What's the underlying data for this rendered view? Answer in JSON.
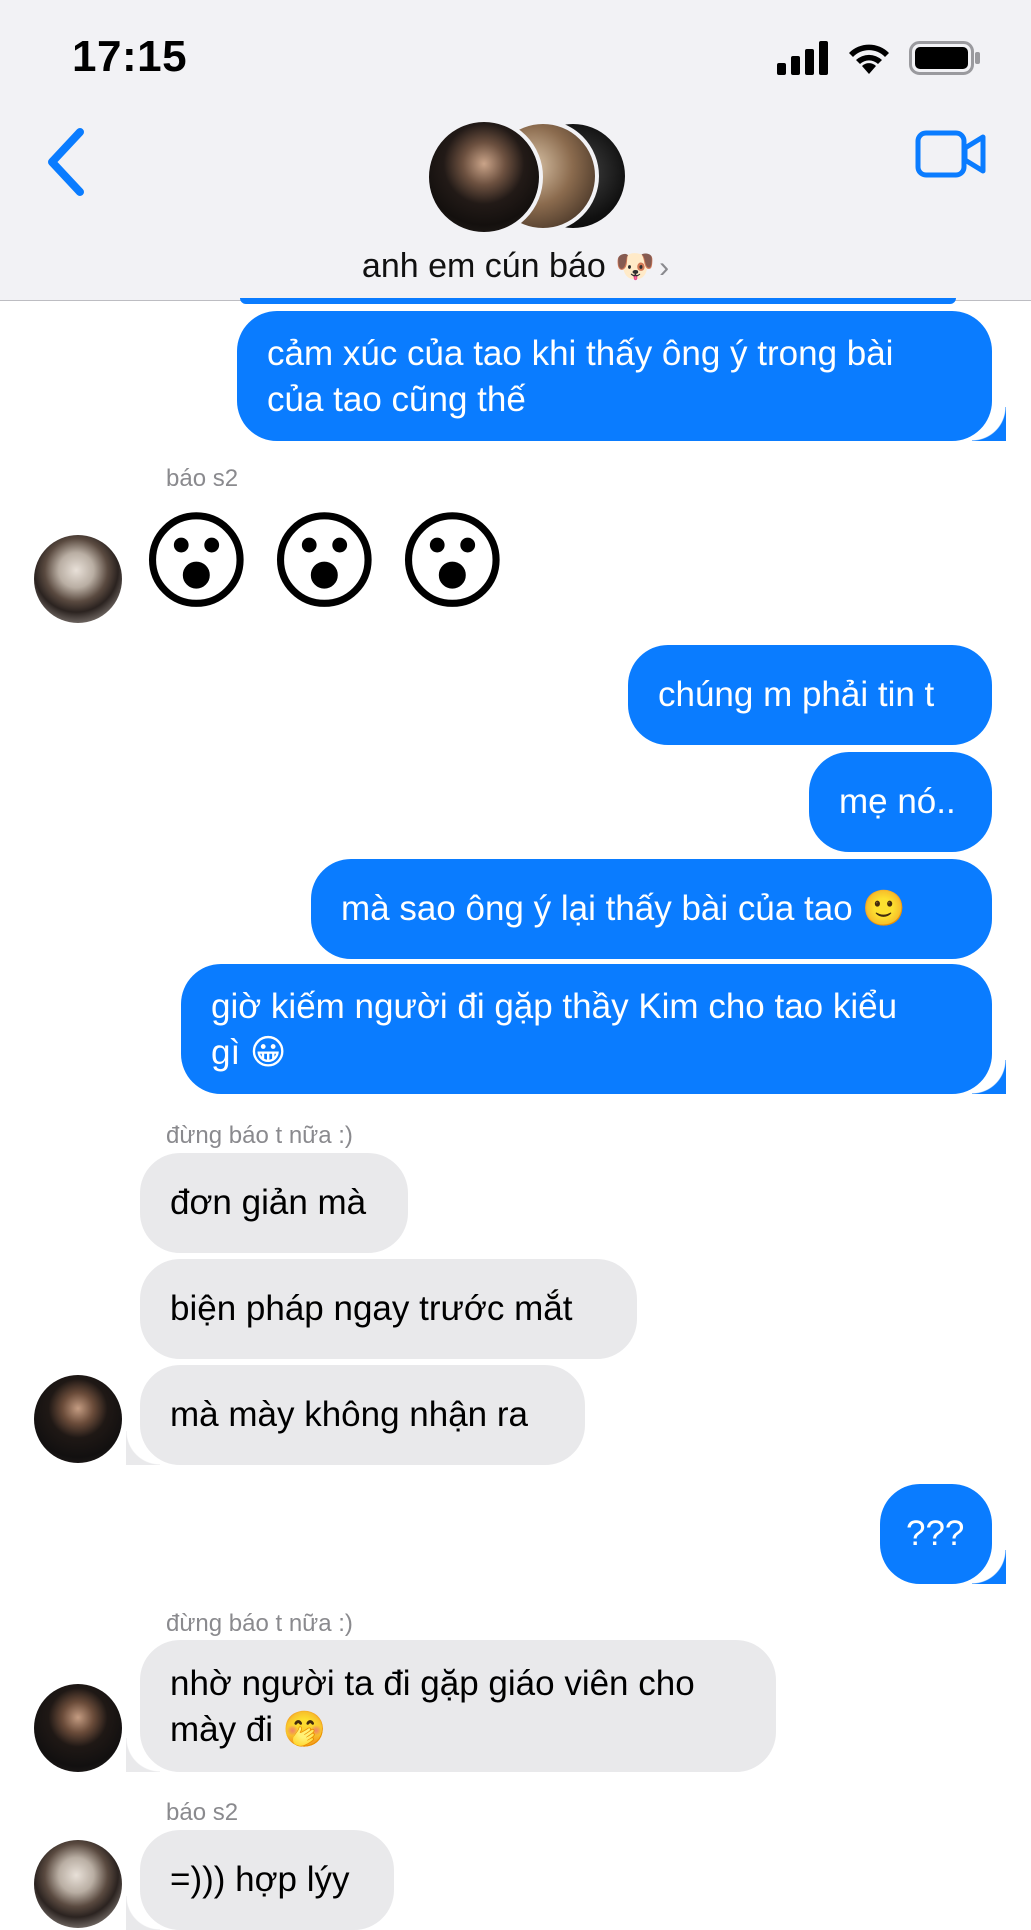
{
  "status_bar": {
    "time": "17:15"
  },
  "header": {
    "group_name": "anh em cún báo",
    "group_emoji": "🐶",
    "icons": {
      "back": "chevron-left-icon",
      "video": "video-camera-icon",
      "chevron": "chevron-right-icon"
    }
  },
  "messages": [
    {
      "dir": "out",
      "lines": [
        "cảm xúc của tao khi thấy ông ý trong bài",
        "của tao cũng thế"
      ]
    },
    {
      "dir": "in",
      "sender": "báo s2",
      "emoji": [
        "😮",
        "😮",
        "😮"
      ]
    },
    {
      "dir": "out",
      "lines": [
        "chúng m phải tin t"
      ]
    },
    {
      "dir": "out",
      "lines": [
        "mẹ nó.."
      ]
    },
    {
      "dir": "out",
      "lines": [
        "mà sao ông ý lại thấy bài của tao 🙂"
      ]
    },
    {
      "dir": "out",
      "lines": [
        "giờ kiếm người đi gặp thầy Kim cho tao kiểu",
        "gì 😀"
      ]
    },
    {
      "dir": "in",
      "sender": "đừng báo t nữa :)",
      "lines": [
        "đơn giản mà"
      ]
    },
    {
      "dir": "in",
      "lines": [
        "biện pháp ngay trước mắt"
      ]
    },
    {
      "dir": "in",
      "lines": [
        "mà mày không nhận ra"
      ]
    },
    {
      "dir": "out",
      "lines": [
        "???"
      ]
    },
    {
      "dir": "in",
      "sender": "đừng báo t nữa :)",
      "lines": [
        "nhờ người ta đi gặp giáo viên cho",
        "mày đi 🤭"
      ]
    },
    {
      "dir": "in",
      "sender": "báo s2",
      "lines": [
        "=))) hợp lýy"
      ]
    }
  ],
  "colors": {
    "outgoing": "#0a7cff",
    "incoming": "#e9e9eb",
    "accent": "#0a7cff"
  }
}
